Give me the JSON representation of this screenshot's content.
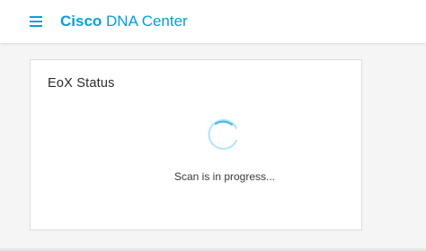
{
  "header": {
    "brand_bold": "Cisco",
    "brand_rest": " DNA Center",
    "menu_icon": "hamburger-menu-icon",
    "accent_color": "#049fd9"
  },
  "card": {
    "title": "EoX Status",
    "spinner_icon": "loading-spinner-icon",
    "status_text": "Scan is in progress..."
  }
}
